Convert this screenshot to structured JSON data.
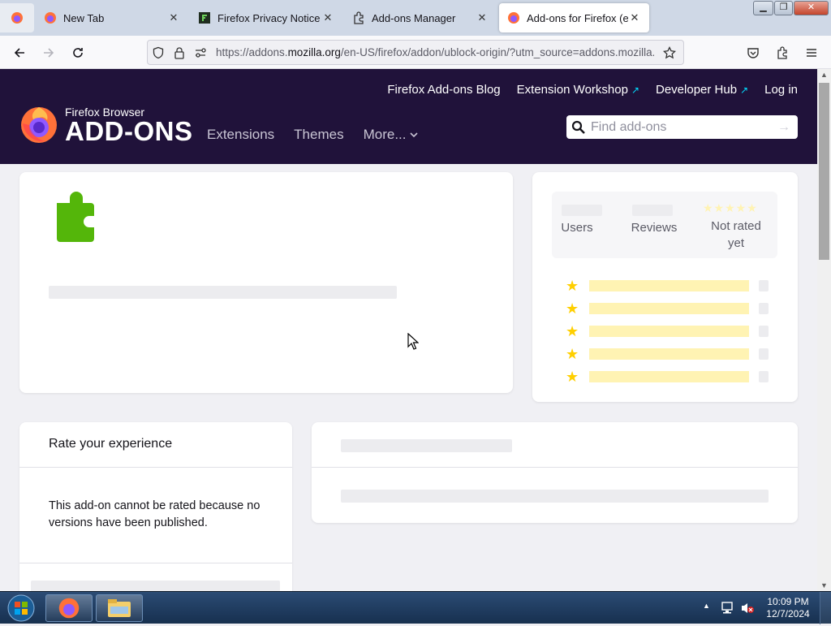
{
  "browser": {
    "tabs": [
      {
        "title": "New Tab",
        "close": "✕"
      },
      {
        "title": "Firefox Privacy Notice —",
        "close": "✕"
      },
      {
        "title": "Add-ons Manager",
        "close": "✕"
      },
      {
        "title": "Add-ons for Firefox (en-US)",
        "close": "✕"
      }
    ],
    "url_prefix": "https://addons.",
    "url_domain": "mozilla.org",
    "url_rest": "/en-US/firefox/addon/ublock-origin/?utm_source=addons.mozilla.org"
  },
  "header": {
    "links": [
      "Firefox Add-ons Blog",
      "Extension Workshop",
      "Developer Hub",
      "Log in"
    ],
    "external_mark": "↗",
    "logo_small": "Firefox Browser",
    "logo_big": "ADD-ONS",
    "nav": [
      "Extensions",
      "Themes",
      "More..."
    ],
    "search_placeholder": "Find add-ons",
    "search_go": "→"
  },
  "stats": {
    "users_label": "Users",
    "reviews_label": "Reviews",
    "rating_label": "Not rated yet",
    "star_glyph": "★"
  },
  "rate": {
    "title": "Rate your experience",
    "message": "This add-on cannot be rated because no versions have been published."
  },
  "taskbar": {
    "time": "10:09 PM",
    "date": "12/7/2024"
  },
  "colors": {
    "header_bg": "#20123a",
    "puzzle_green": "#54b60a",
    "star_yellow": "#ffcf00",
    "skeleton_yellow": "#fff3b3"
  }
}
